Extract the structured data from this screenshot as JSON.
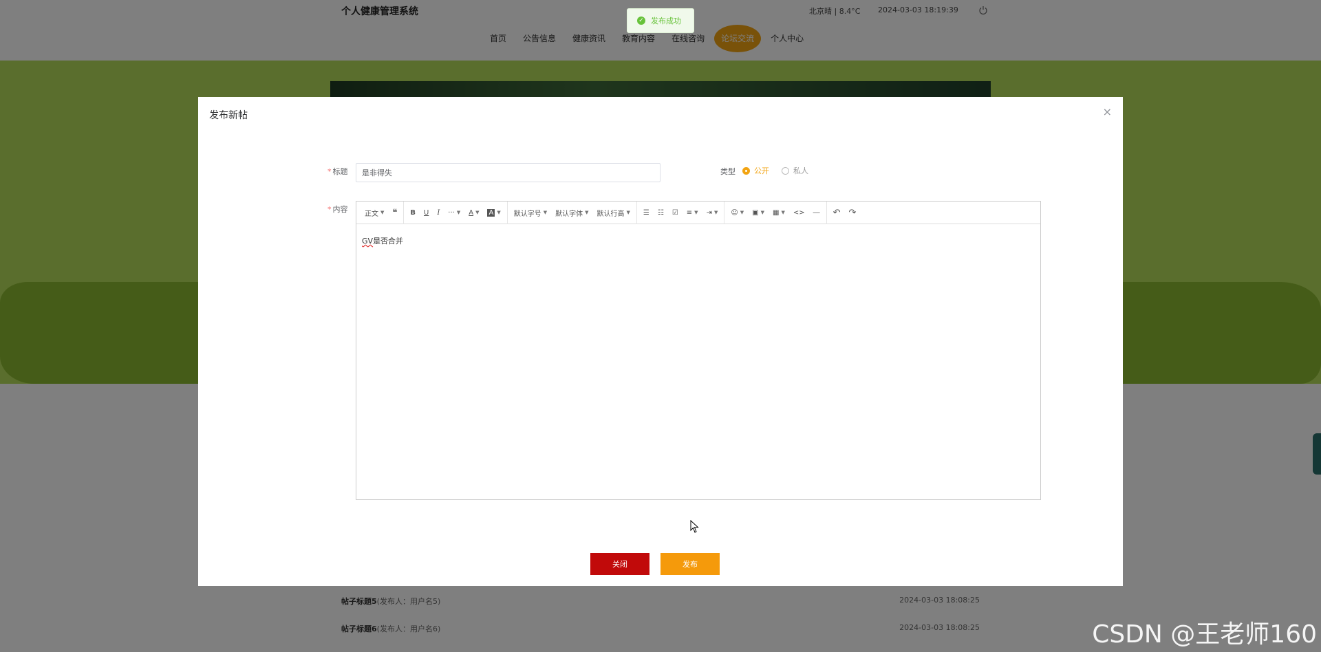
{
  "header": {
    "site_title": "个人健康管理系统",
    "weather": "北京晴 | 8.4°C",
    "datetime": "2024-03-03   18:19:39",
    "nav": [
      "首页",
      "公告信息",
      "健康资讯",
      "教育内容",
      "在线咨询",
      "论坛交流",
      "个人中心"
    ],
    "active_nav": "论坛交流",
    "accent": "#f2a413"
  },
  "posts": [
    {
      "title": "帖子标题5",
      "author": "(发布人：用户名5)",
      "date": "2024-03-03 18:08:25"
    },
    {
      "title": "帖子标题6",
      "author": "(发布人：用户名6)",
      "date": "2024-03-03 18:08:25"
    }
  ],
  "toast": {
    "message": "发布成功",
    "icon": "check-circle-icon"
  },
  "dialog": {
    "title": "发布新帖",
    "close": "×",
    "form": {
      "title_label": "标题",
      "title_value": "是非得失",
      "type_label": "类型",
      "type_options": [
        "公开",
        "私人"
      ],
      "type_selected": "公开",
      "content_label": "内容",
      "content_value": "是否合并",
      "content_prefix": "GV"
    },
    "toolbar": {
      "paragraph": "正文",
      "quote": "❝",
      "bold": "B",
      "underline": "U",
      "italic": "I",
      "more": "···",
      "font_color": "A",
      "bg_color": "A",
      "font_size": "默认字号",
      "font_family": "默认字体",
      "line_height": "默认行高",
      "bullet_list": "☰",
      "numbered_list": "☷",
      "todo": "☑",
      "align": "≡",
      "indent": "⇥",
      "emoji": "☺",
      "image": "▣",
      "table": "▦",
      "code": "<>",
      "divider": "―",
      "undo": "↶",
      "redo": "↷"
    },
    "buttons": {
      "close": "关闭",
      "publish": "发布"
    }
  },
  "watermark": "CSDN @王老师160"
}
